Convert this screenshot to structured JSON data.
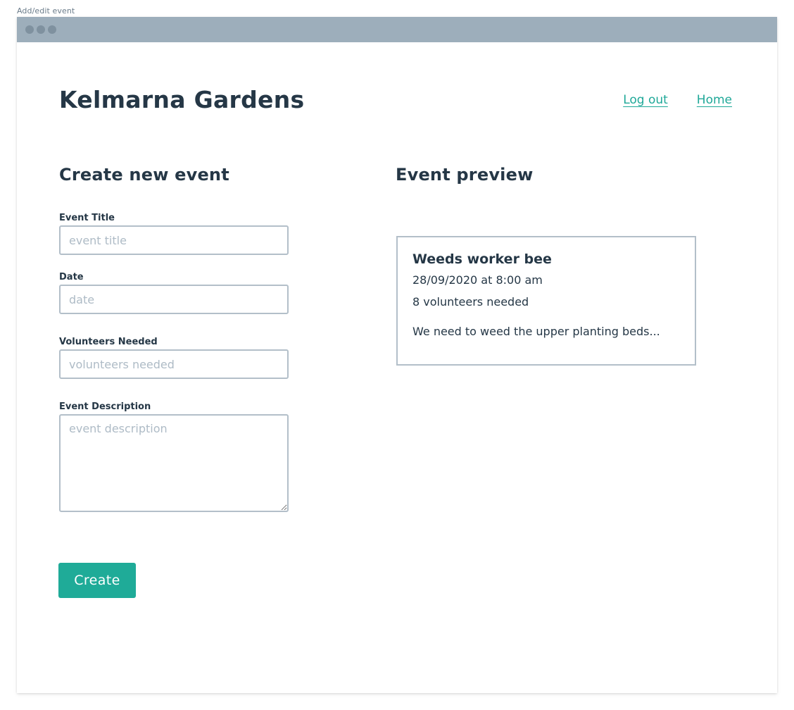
{
  "frame": {
    "label": "Add/edit event"
  },
  "site": {
    "title": "Kelmarna Gardens"
  },
  "nav": {
    "logout": "Log out",
    "home": "Home"
  },
  "form": {
    "heading": "Create new event",
    "fields": {
      "title": {
        "label": "Event Title",
        "placeholder": "event title",
        "value": ""
      },
      "date": {
        "label": "Date",
        "placeholder": "date",
        "value": ""
      },
      "volunteers": {
        "label": "Volunteers Needed",
        "placeholder": "volunteers needed",
        "value": ""
      },
      "description": {
        "label": "Event Description",
        "placeholder": "event description",
        "value": ""
      }
    },
    "submit_label": "Create"
  },
  "preview": {
    "heading": "Event preview",
    "title": "Weeds worker bee",
    "datetime": "28/09/2020 at 8:00 am",
    "volunteers": "8 volunteers needed",
    "description": "We need to weed the upper planting beds..."
  },
  "colors": {
    "accent": "#1fab98",
    "text": "#253746",
    "titlebar": "#9daebb",
    "border": "#b3bfc9"
  }
}
